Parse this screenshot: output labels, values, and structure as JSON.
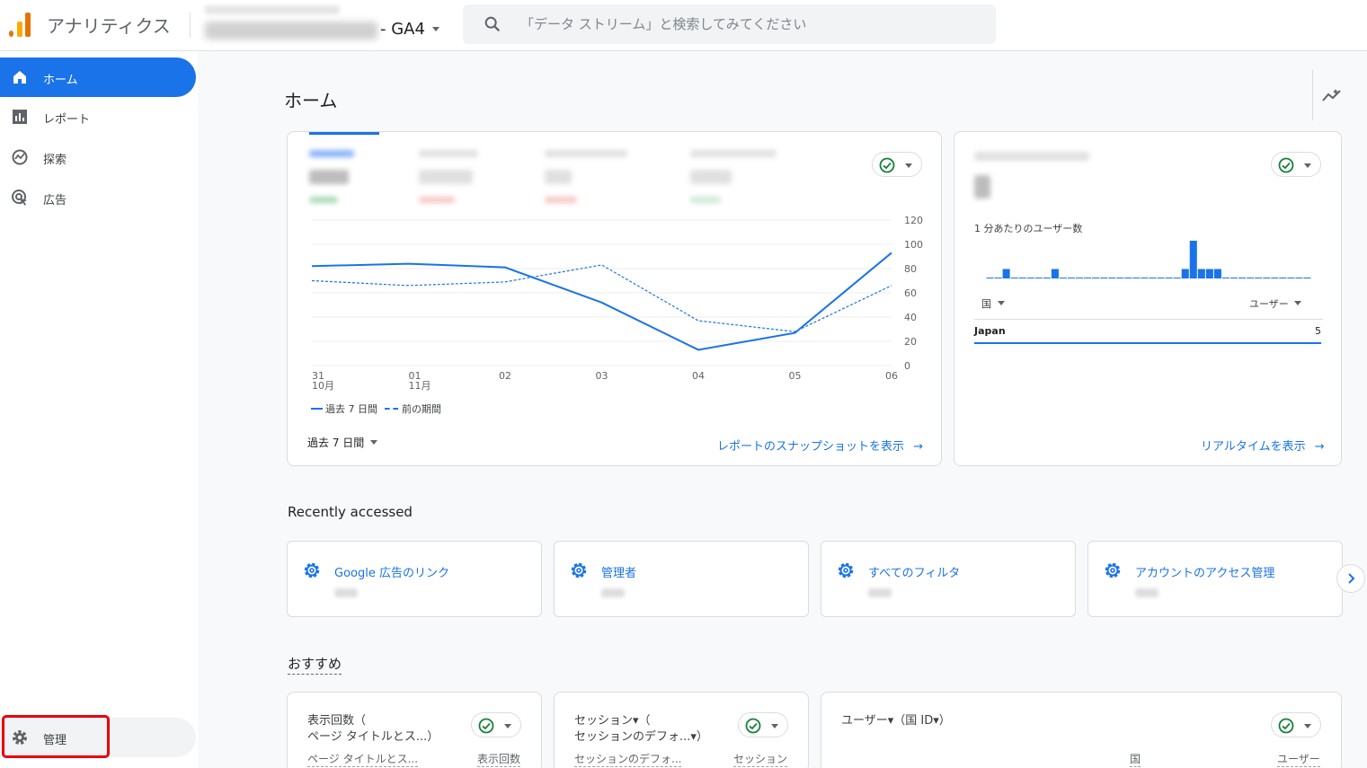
{
  "app": {
    "title": "アナリティクス",
    "property_suffix": "- GA4"
  },
  "search": {
    "placeholder": "「データ ストリーム」と検索してみてください"
  },
  "sidebar": {
    "items": [
      {
        "label": "ホーム",
        "icon": "home-icon",
        "active": true
      },
      {
        "label": "レポート",
        "icon": "bar-chart-icon",
        "active": false
      },
      {
        "label": "探索",
        "icon": "explore-icon",
        "active": false
      },
      {
        "label": "広告",
        "icon": "advertising-icon",
        "active": false
      }
    ],
    "admin_label": "管理"
  },
  "main": {
    "title": "ホーム"
  },
  "overview_card": {
    "y_ticks": [
      "120",
      "100",
      "80",
      "60",
      "40",
      "20",
      "0"
    ],
    "x_ticks": [
      {
        "top": "31",
        "bottom": "10月"
      },
      {
        "top": "01",
        "bottom": "11月"
      },
      {
        "top": "02",
        "bottom": ""
      },
      {
        "top": "03",
        "bottom": ""
      },
      {
        "top": "04",
        "bottom": ""
      },
      {
        "top": "05",
        "bottom": ""
      },
      {
        "top": "06",
        "bottom": ""
      }
    ],
    "legend_current": "過去 7 日間",
    "legend_previous": "前の期間",
    "date_range": "過去 7 日間",
    "snapshot_link": "レポートのスナップショットを表示",
    "series_current": [
      82,
      84,
      81,
      52,
      13,
      27,
      93
    ],
    "series_previous": [
      70,
      66,
      69,
      83,
      37,
      28,
      66
    ]
  },
  "realtime_card": {
    "per_minute_label": "1 分あたりのユーザー数",
    "bars": [
      0,
      0,
      1,
      0,
      0,
      0,
      0,
      0,
      1,
      0,
      0,
      0,
      0,
      0,
      0,
      0,
      0,
      0,
      0,
      0,
      0,
      0,
      0,
      0,
      1,
      4,
      1,
      1,
      1,
      0,
      0,
      0,
      0,
      0,
      0,
      0,
      0,
      0,
      0,
      0
    ],
    "col_country": "国",
    "col_users": "ユーザー",
    "rows": [
      {
        "country": "Japan",
        "users": "5"
      }
    ],
    "link": "リアルタイムを表示"
  },
  "recent": {
    "heading": "Recently accessed",
    "items": [
      {
        "label": "Google 広告のリンク"
      },
      {
        "label": "管理者"
      },
      {
        "label": "すべてのフィルタ"
      },
      {
        "label": "アカウントのアクセス管理"
      }
    ]
  },
  "recommended": {
    "heading": "おすすめ",
    "cards": [
      {
        "title_line1": "表示回数（",
        "title_line2": "ページ タイトルとス...）",
        "col1": "ページ タイトルとス...",
        "col2": "表示回数"
      },
      {
        "title_line1": "セッション▾（",
        "title_line2": "セッションのデフォ...▾）",
        "col1": "セッションのデフォ...",
        "col2": "セッション"
      },
      {
        "title_line1": "ユーザー▾（国 ID▾）",
        "title_line2": "",
        "col1": "国",
        "col2": "ユーザー"
      }
    ]
  },
  "colors": {
    "accent": "#1a73e8",
    "check": "#188038",
    "highlight": "#e8000b"
  }
}
